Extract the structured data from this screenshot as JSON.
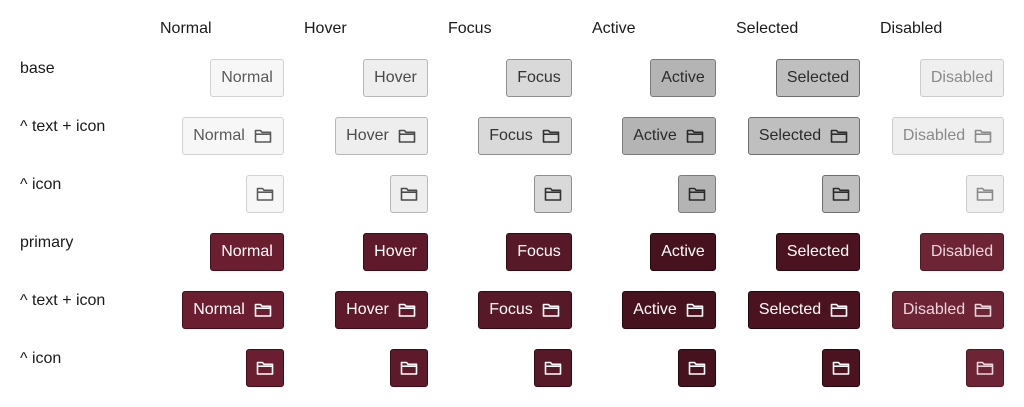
{
  "columns": [
    "Normal",
    "Hover",
    "Focus",
    "Active",
    "Selected",
    "Disabled"
  ],
  "rows": [
    {
      "label": "base"
    },
    {
      "label": "^ text + icon"
    },
    {
      "label": "^ icon"
    },
    {
      "label": "primary"
    },
    {
      "label": "^ text + icon"
    },
    {
      "label": "^ icon"
    }
  ],
  "buttons": {
    "normal": "Normal",
    "hover": "Hover",
    "focus": "Focus",
    "active": "Active",
    "selected": "Selected",
    "disabled": "Disabled"
  },
  "icon_name": "folder-icon",
  "colors": {
    "primary_normal": "#6b1e30",
    "primary_active": "#45121e",
    "base_normal": "#f7f7f7",
    "base_active": "#b4b4b4"
  }
}
